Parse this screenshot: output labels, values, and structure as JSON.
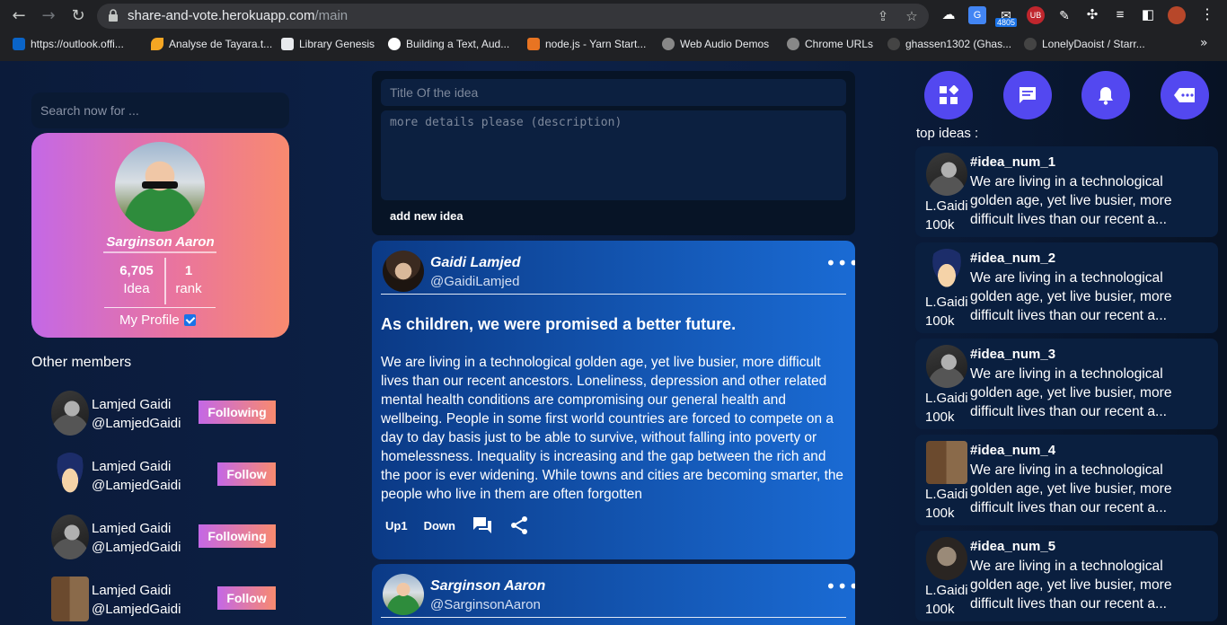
{
  "browser": {
    "url_host": "share-and-vote.herokuapp.com",
    "url_path": "/main",
    "ext_badge": "4805",
    "bookmarks": [
      {
        "label": "https://outlook.offi..."
      },
      {
        "label": "Analyse de Tayara.t..."
      },
      {
        "label": "Library Genesis"
      },
      {
        "label": "Building a Text, Aud..."
      },
      {
        "label": "node.js - Yarn Start..."
      },
      {
        "label": "Web Audio Demos"
      },
      {
        "label": "Chrome URLs"
      },
      {
        "label": "ghassen1302 (Ghas..."
      },
      {
        "label": "LonelyDaoist / Starr..."
      }
    ]
  },
  "search": {
    "placeholder": "Search now for ..."
  },
  "profile": {
    "name": "Sarginson Aaron",
    "idea_count": "6,705",
    "idea_label": "Idea",
    "rank": "1",
    "rank_label": "rank",
    "my_profile_label": "My Profile"
  },
  "members": {
    "title": "Other members",
    "items": [
      {
        "name": "Lamjed Gaidi",
        "handle": "@LamjedGaidi",
        "button": "Following"
      },
      {
        "name": "Lamjed Gaidi",
        "handle": "@LamjedGaidi",
        "button": "Follow"
      },
      {
        "name": "Lamjed Gaidi",
        "handle": "@LamjedGaidi",
        "button": "Following"
      },
      {
        "name": "Lamjed Gaidi",
        "handle": "@LamjedGaidi",
        "button": "Follow"
      }
    ]
  },
  "composer": {
    "title_placeholder": "Title Of the idea",
    "desc_placeholder": "more details please (description)",
    "add_label": "add new idea"
  },
  "posts": [
    {
      "author": "Gaidi Lamjed",
      "handle": "@GaidiLamjed",
      "title": "As children, we were promised a better future.",
      "body": "We are living in a technological golden age, yet live busier, more difficult lives than our recent ancestors. Loneliness, depression and other related mental health conditions are compromising our general health and wellbeing. People in some first world countries are forced to compete on a day to day basis just to be able to survive, without falling into poverty or homelessness. Inequality is increasing and the gap between the rich and the poor is ever widening. While towns and cities are becoming smarter, the people who live in them are often forgotten",
      "up_label": "Up1",
      "down_label": "Down"
    },
    {
      "author": "Sarginson Aaron",
      "handle": "@SarginsonAaron"
    }
  ],
  "top_ideas": {
    "title": "top ideas :",
    "items": [
      {
        "id": "#idea_num_1",
        "user": "L.Gaidi",
        "score": "100k",
        "text": "We are living in a technological golden age, yet live busier, more difficult lives than our recent a..."
      },
      {
        "id": "#idea_num_2",
        "user": "L.Gaidi",
        "score": "100k",
        "text": "We are living in a technological golden age, yet live busier, more difficult lives than our recent a..."
      },
      {
        "id": "#idea_num_3",
        "user": "L.Gaidi",
        "score": "100k",
        "text": "We are living in a technological golden age, yet live busier, more difficult lives than our recent a..."
      },
      {
        "id": "#idea_num_4",
        "user": "L.Gaidi",
        "score": "100k",
        "text": "We are living in a technological golden age, yet live busier, more difficult lives than our recent a..."
      },
      {
        "id": "#idea_num_5",
        "user": "L.Gaidi",
        "score": "100k",
        "text": "We are living in a technological golden age, yet live busier, more difficult lives than our recent a..."
      }
    ]
  },
  "colors": {
    "accent_purple": "#5348f0",
    "gradient_start": "#c468e6",
    "gradient_end": "#f88a6f",
    "post_blue": "#1a6bd4"
  }
}
